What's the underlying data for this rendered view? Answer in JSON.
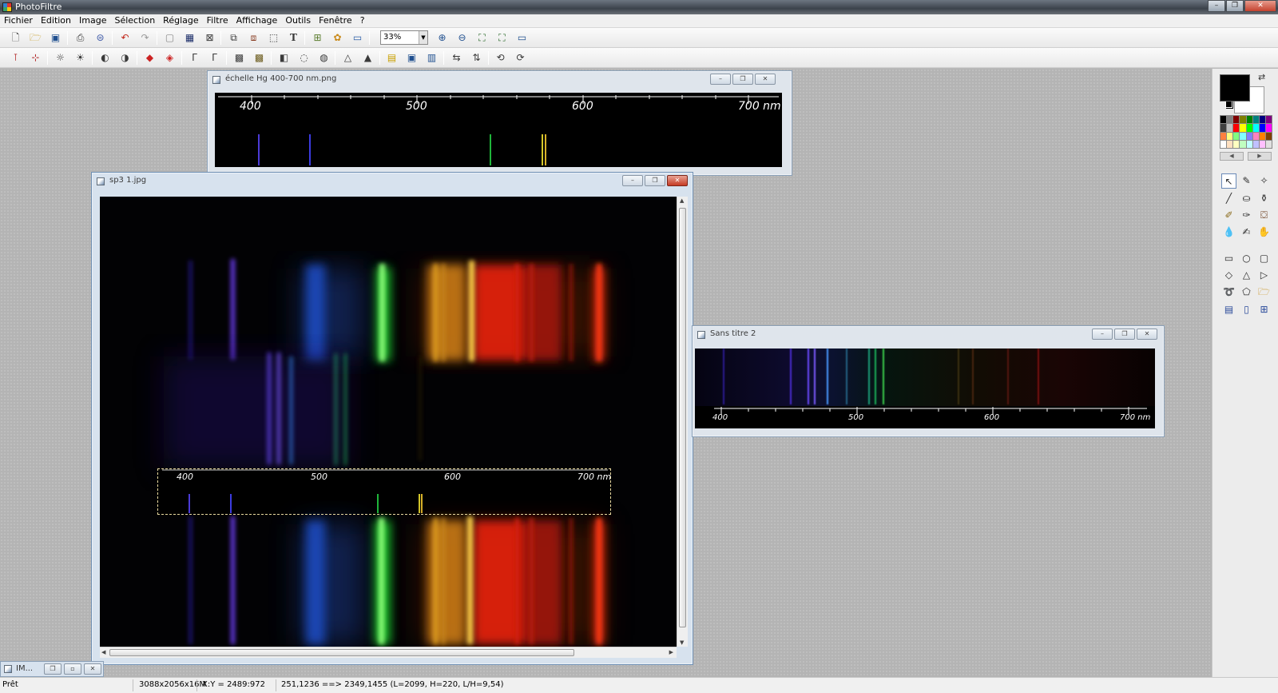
{
  "app": {
    "title": "PhotoFiltre",
    "window_controls": [
      "–",
      "❐",
      "✕"
    ]
  },
  "menu": [
    "Fichier",
    "Edition",
    "Image",
    "Sélection",
    "Réglage",
    "Filtre",
    "Affichage",
    "Outils",
    "Fenêtre",
    "?"
  ],
  "toolbar": {
    "zoom_value": "33%"
  },
  "windows": {
    "scale": {
      "title": "échelle Hg 400-700 nm.png",
      "labels": [
        "400",
        "500",
        "600",
        "700 nm"
      ]
    },
    "sp3": {
      "title": "sp3 1.jpg",
      "overlay_labels": [
        "400",
        "500",
        "600",
        "700 nm"
      ]
    },
    "untitled": {
      "title": "Sans titre 2",
      "labels": [
        "400",
        "500",
        "600",
        "700 nm"
      ]
    },
    "minimized": {
      "title": "IM..."
    }
  },
  "palette": {
    "fg_color": "#000000",
    "bg_color": "#ffffff",
    "colors": [
      "#000000",
      "#808080",
      "#800000",
      "#808000",
      "#008000",
      "#008080",
      "#000080",
      "#800080",
      "#404040",
      "#c0c0c0",
      "#ff0000",
      "#ffff00",
      "#00ff00",
      "#00ffff",
      "#0000ff",
      "#ff00ff",
      "#ff8040",
      "#ffff80",
      "#80ff80",
      "#80ffff",
      "#8080ff",
      "#ff80c0",
      "#ff8000",
      "#804000",
      "#ffffff",
      "#ffe0c0",
      "#ffffc0",
      "#c0ffc0",
      "#c0ffff",
      "#c0c0ff",
      "#ffc0ff",
      "#e0e0e0"
    ]
  },
  "status": {
    "ready": "Prêt",
    "image_info": "3088x2056x16M",
    "cursor": "X:Y = 2489:972",
    "selection": "251,1236 ==> 2349,1455 (L=2099, H=220, L/H=9,54)"
  }
}
